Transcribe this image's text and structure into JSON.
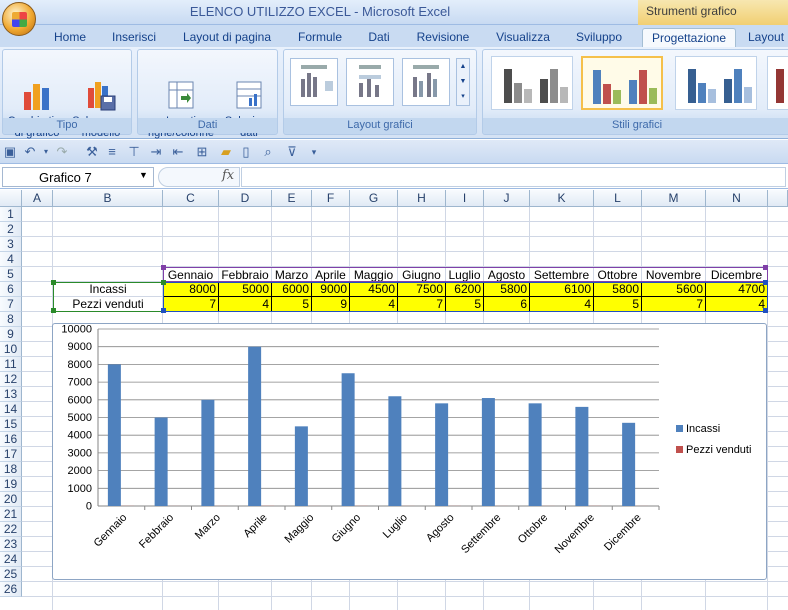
{
  "window": {
    "title": "ELENCO UTILIZZO EXCEL - Microsoft Excel",
    "context_title": "Strumenti grafico"
  },
  "tabs": [
    {
      "label": "Home"
    },
    {
      "label": "Inserisci"
    },
    {
      "label": "Layout di pagina"
    },
    {
      "label": "Formule"
    },
    {
      "label": "Dati"
    },
    {
      "label": "Revisione"
    },
    {
      "label": "Visualizza"
    },
    {
      "label": "Sviluppo"
    },
    {
      "label": "Progettazione"
    },
    {
      "label": "Layout"
    }
  ],
  "ribbon": {
    "tipo": {
      "label": "Tipo",
      "change_type": "Cambia tipo\ndi grafico",
      "save_model": "Salva come\nmodello"
    },
    "dati": {
      "label": "Dati",
      "switch": "Inverti\nrighe/colonne",
      "select": "Seleziona\ndati"
    },
    "layout": {
      "label": "Layout grafici"
    },
    "styles": {
      "label": "Stili grafici"
    }
  },
  "formula_bar": {
    "name_box": "Grafico 7",
    "fx": "fx",
    "formula": ""
  },
  "columns": [
    "A",
    "B",
    "C",
    "D",
    "E",
    "F",
    "G",
    "H",
    "I",
    "J",
    "K",
    "L",
    "M",
    "N"
  ],
  "rows": [
    "1",
    "2",
    "3",
    "4",
    "5",
    "6",
    "7",
    "8",
    "9",
    "10",
    "11",
    "12",
    "13",
    "14",
    "15",
    "16",
    "17",
    "18",
    "19",
    "20",
    "21",
    "22",
    "23",
    "24",
    "25",
    "26"
  ],
  "sheet": {
    "months": [
      "Gennaio",
      "Febbraio",
      "Marzo",
      "Aprile",
      "Maggio",
      "Giugno",
      "Luglio",
      "Agosto",
      "Settembre",
      "Ottobre",
      "Novembre",
      "Dicembre"
    ],
    "incassi_label": "Incassi",
    "pezzi_label": "Pezzi venduti",
    "incassi": [
      "8000",
      "5000",
      "6000",
      "9000",
      "4500",
      "7500",
      "6200",
      "5800",
      "6100",
      "5800",
      "5600",
      "4700"
    ],
    "pezzi": [
      "7",
      "4",
      "5",
      "9",
      "4",
      "7",
      "5",
      "6",
      "4",
      "5",
      "7",
      "4"
    ]
  },
  "chart_data": {
    "type": "bar",
    "categories": [
      "Gennaio",
      "Febbraio",
      "Marzo",
      "Aprile",
      "Maggio",
      "Giugno",
      "Luglio",
      "Agosto",
      "Settembre",
      "Ottobre",
      "Novembre",
      "Dicembre"
    ],
    "series": [
      {
        "name": "Incassi",
        "values": [
          8000,
          5000,
          6000,
          9000,
          4500,
          7500,
          6200,
          5800,
          6100,
          5800,
          5600,
          4700
        ],
        "color": "#4f81bd"
      },
      {
        "name": "Pezzi venduti",
        "values": [
          7,
          4,
          5,
          9,
          4,
          7,
          5,
          6,
          4,
          5,
          7,
          4
        ],
        "color": "#c0504d"
      }
    ],
    "yticks": [
      "0",
      "1000",
      "2000",
      "3000",
      "4000",
      "5000",
      "6000",
      "7000",
      "8000",
      "9000",
      "10000"
    ],
    "ylim": [
      0,
      10000
    ],
    "grid": true,
    "legend": "right"
  },
  "colors": {
    "highlight": "#ffff00",
    "accent": "#4f81bd",
    "series2": "#c0504d"
  }
}
